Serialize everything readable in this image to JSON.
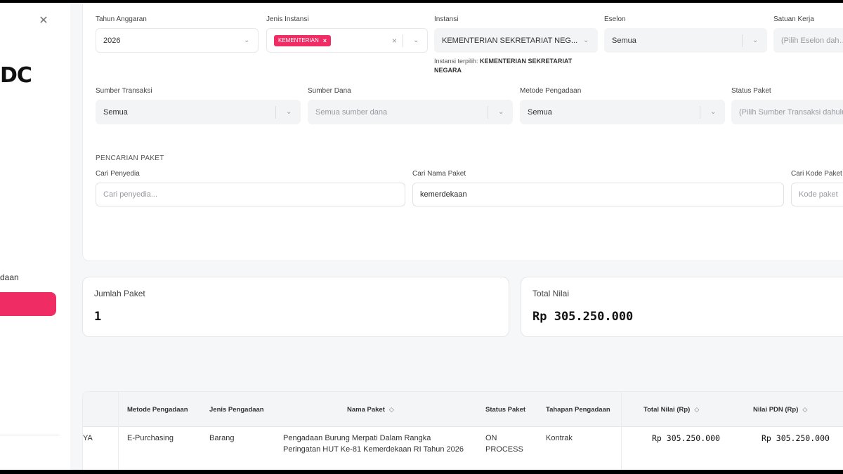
{
  "sidebar": {
    "close_icon": "close-icon",
    "brand_fragment": "DC",
    "label_fragment": "daan"
  },
  "filters": {
    "tahun": {
      "label": "Tahun Anggaran",
      "value": "2026"
    },
    "jenis_instansi": {
      "label": "Jenis Instansi",
      "tag": "KEMENTERIAN"
    },
    "instansi": {
      "label": "Instansi",
      "value": "KEMENTERIAN SEKRETARIAT NEG...",
      "note_prefix": "Instansi terpilih:",
      "note_value": "KEMENTERIAN SEKRETARIAT NEGARA"
    },
    "eselon": {
      "label": "Eselon",
      "value": "Semua"
    },
    "satuan_kerja": {
      "label": "Satuan Kerja",
      "placeholder": "(Pilih Eselon dahulu)"
    },
    "sumber_transaksi": {
      "label": "Sumber Transaksi",
      "value": "Semua"
    },
    "sumber_dana": {
      "label": "Sumber Dana",
      "placeholder": "Semua sumber dana"
    },
    "metode_pengadaan": {
      "label": "Metode Pengadaan",
      "value": "Semua"
    },
    "status_paket": {
      "label": "Status Paket",
      "placeholder": "(Pilih Sumber Transaksi dahulu)"
    }
  },
  "search": {
    "section_title": "PENCARIAN PAKET",
    "penyedia": {
      "label": "Cari Penyedia",
      "placeholder": "Cari penyedia..."
    },
    "nama_paket": {
      "label": "Cari Nama Paket",
      "value": "kemerdekaan"
    },
    "kode_paket": {
      "label": "Cari Kode Paket",
      "placeholder": "Kode paket"
    }
  },
  "stats": {
    "jumlah_label": "Jumlah Paket",
    "jumlah_value": "1",
    "total_label": "Total Nilai",
    "total_value": "Rp 305.250.000"
  },
  "table": {
    "headers": {
      "metode": "Metode Pengadaan",
      "jenis": "Jenis Pengadaan",
      "nama": "Nama Paket",
      "status": "Status Paket",
      "tahapan": "Tahapan Pengadaan",
      "total": "Total Nilai (Rp)",
      "pdn": "Nilai PDN (Rp)"
    },
    "rows": [
      {
        "prefix": "YA",
        "metode": "E-Purchasing",
        "jenis": "Barang",
        "nama": "Pengadaan Burung Merpati Dalam Rangka Peringatan HUT Ke-81 Kemerdekaan RI Tahun 2026",
        "status": "ON PROCESS",
        "tahapan": "Kontrak",
        "total": "Rp 305.250.000",
        "pdn": "Rp 305.250.000"
      }
    ]
  },
  "colors": {
    "accent": "#ef2c63",
    "background": "#f6f7f9"
  }
}
